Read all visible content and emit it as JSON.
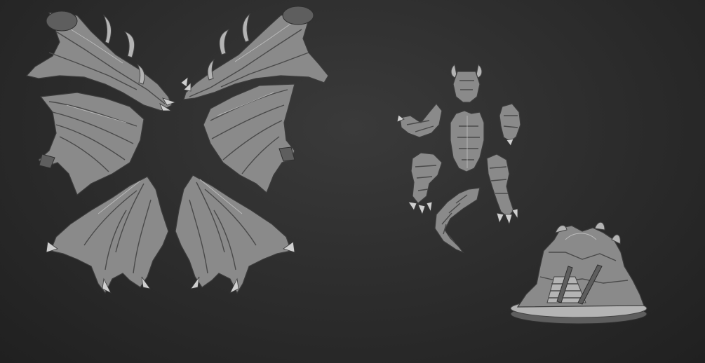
{
  "scene": {
    "background": "#2b2b2b",
    "material_color": "#8a8a8a",
    "groups": [
      "wing-parts",
      "body-parts",
      "base"
    ]
  }
}
